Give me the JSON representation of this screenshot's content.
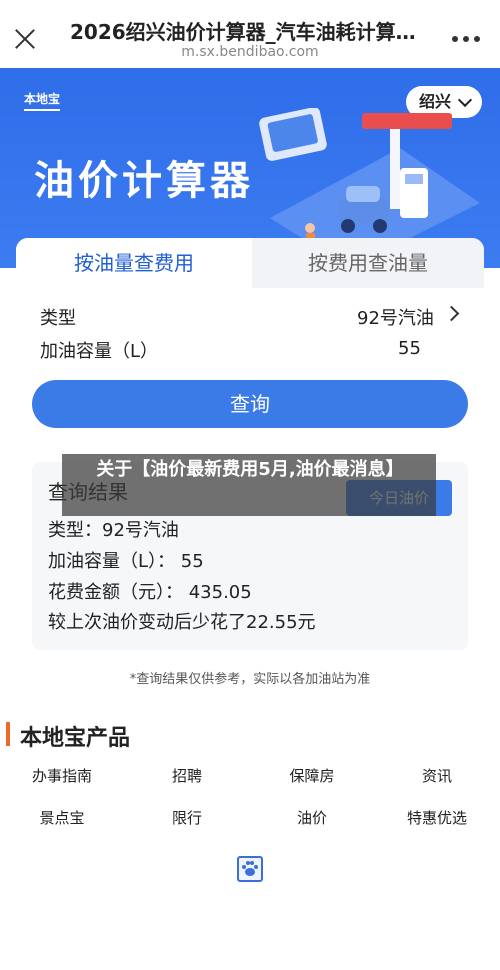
{
  "browser": {
    "title": "2026绍兴油价计算器_汽车油耗计算…",
    "url": "m.sx.bendibao.com"
  },
  "hero": {
    "logo": "本地宝",
    "title": "油价计算器",
    "city": "绍兴"
  },
  "tabs": {
    "active": "按油量查费用",
    "inactive": "按费用查油量"
  },
  "form": {
    "type_label": "类型",
    "type_value": "92号汽油",
    "volume_label": "加油容量（L）",
    "volume_value": "55",
    "query_button": "查询"
  },
  "result": {
    "title": "查询结果",
    "today_button": "今日油价",
    "line1": "类型：92号汽油",
    "line2": "加油容量（L）：  55",
    "line3": "花费金额（元）：  435.05",
    "line4": "较上次油价变动后少花了22.55元"
  },
  "note": "*查询结果仅供参考，实际以各加油站为准",
  "overlay": {
    "text": "关于【油价最新费用5月,油价最消息】"
  },
  "products": {
    "title": "本地宝产品",
    "items": [
      "办事指南",
      "招聘",
      "保障房",
      "资讯",
      "景点宝",
      "限行",
      "油价",
      "特惠优选"
    ]
  },
  "colors": {
    "brand_blue": "#3a7be8",
    "hero_blue": "#2f6de9",
    "accent_orange": "#ee6a2b"
  }
}
